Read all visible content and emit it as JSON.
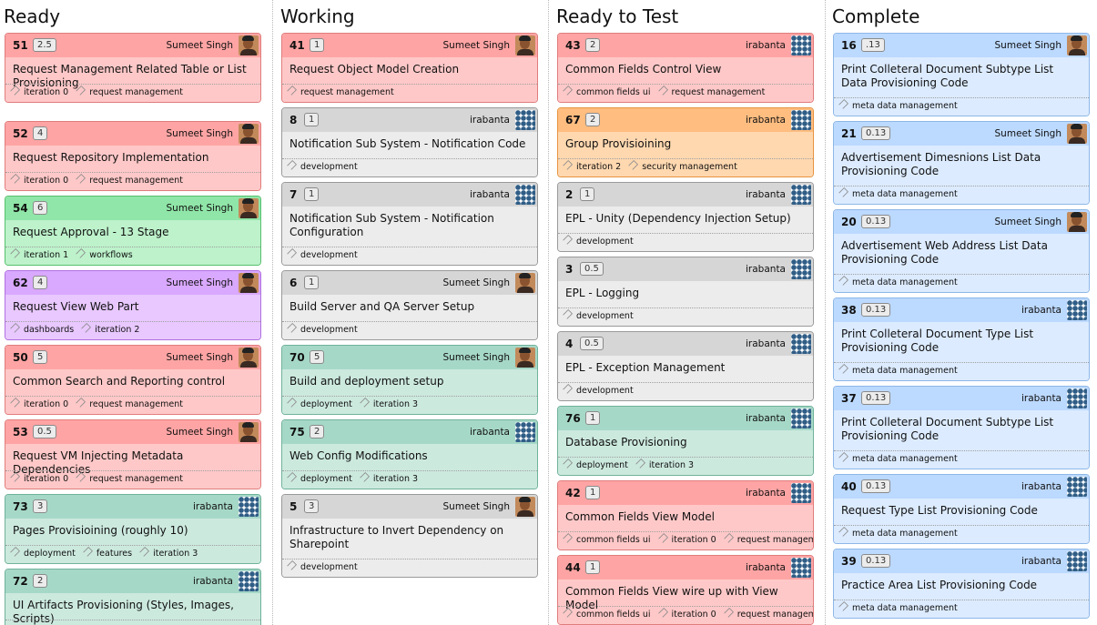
{
  "columns": [
    {
      "title": "Ready",
      "cards": [
        {
          "id": "51",
          "size": "2.5",
          "owner": "Sumeet Singh",
          "avatar": "person",
          "color": "red",
          "title": "Request Management Related Table or List Provisioning",
          "tags": [
            "iteration 0",
            "request management"
          ]
        },
        {
          "id": "52",
          "size": "4",
          "owner": "Sumeet Singh",
          "avatar": "person",
          "color": "red",
          "title": "Request Repository Implementation",
          "tags": [
            "iteration 0",
            "request management"
          ]
        },
        {
          "id": "54",
          "size": "6",
          "owner": "Sumeet Singh",
          "avatar": "person",
          "color": "green",
          "title": "Request Approval - 13 Stage",
          "tags": [
            "iteration 1",
            "workflows"
          ]
        },
        {
          "id": "62",
          "size": "4",
          "owner": "Sumeet Singh",
          "avatar": "person",
          "color": "purple",
          "title": "Request View Web Part",
          "tags": [
            "dashboards",
            "iteration 2"
          ]
        },
        {
          "id": "50",
          "size": "5",
          "owner": "Sumeet Singh",
          "avatar": "person",
          "color": "red",
          "title": "Common Search and Reporting control",
          "tags": [
            "iteration 0",
            "request management"
          ]
        },
        {
          "id": "53",
          "size": "0.5",
          "owner": "Sumeet Singh",
          "avatar": "person",
          "color": "red",
          "title": "Request VM Injecting Metadata Dependencies",
          "tags": [
            "iteration 0",
            "request management"
          ]
        },
        {
          "id": "73",
          "size": "3",
          "owner": "irabanta",
          "avatar": "pattern",
          "color": "teal",
          "title": "Pages Provisioining (roughly 10)",
          "tags": [
            "deployment",
            "features",
            "iteration 3"
          ]
        },
        {
          "id": "72",
          "size": "2",
          "owner": "irabanta",
          "avatar": "pattern",
          "color": "teal",
          "title": "UI Artifacts Provisioning (Styles, Images, Scripts)",
          "tags": []
        }
      ]
    },
    {
      "title": "Working",
      "cards": [
        {
          "id": "41",
          "size": "1",
          "owner": "Sumeet Singh",
          "avatar": "person",
          "color": "red",
          "title": "Request Object Model Creation",
          "tags": [
            "request management"
          ]
        },
        {
          "id": "8",
          "size": "1",
          "owner": "irabanta",
          "avatar": "pattern",
          "color": "gray",
          "title": "Notification Sub System - Notification Code",
          "tags": [
            "development"
          ]
        },
        {
          "id": "7",
          "size": "1",
          "owner": "irabanta",
          "avatar": "pattern",
          "color": "gray",
          "title": "Notification Sub System - Notification Configuration",
          "tags": [
            "development"
          ]
        },
        {
          "id": "6",
          "size": "1",
          "owner": "Sumeet Singh",
          "avatar": "person",
          "color": "gray",
          "title": "Build Server and QA Server Setup",
          "tags": [
            "development"
          ]
        },
        {
          "id": "70",
          "size": "5",
          "owner": "Sumeet Singh",
          "avatar": "person",
          "color": "teal",
          "title": "Build and deployment setup",
          "tags": [
            "deployment",
            "iteration 3"
          ]
        },
        {
          "id": "75",
          "size": "2",
          "owner": "irabanta",
          "avatar": "pattern",
          "color": "teal",
          "title": "Web Config Modifications",
          "tags": [
            "deployment",
            "iteration 3"
          ]
        },
        {
          "id": "5",
          "size": "3",
          "owner": "Sumeet Singh",
          "avatar": "person",
          "color": "gray",
          "title": "Infrastructure to Invert Dependency on Sharepoint",
          "tags": [
            "development"
          ]
        }
      ]
    },
    {
      "title": "Ready to Test",
      "cards": [
        {
          "id": "43",
          "size": "2",
          "owner": "irabanta",
          "avatar": "pattern",
          "color": "red",
          "title": "Common Fields Control View",
          "tags": [
            "common fields ui",
            "request management"
          ]
        },
        {
          "id": "67",
          "size": "2",
          "owner": "irabanta",
          "avatar": "pattern",
          "color": "orange",
          "title": "Group Provisioining",
          "tags": [
            "iteration 2",
            "security management"
          ]
        },
        {
          "id": "2",
          "size": "1",
          "owner": "irabanta",
          "avatar": "pattern",
          "color": "gray",
          "title": "EPL - Unity (Dependency Injection Setup)",
          "tags": [
            "development"
          ]
        },
        {
          "id": "3",
          "size": "0.5",
          "owner": "irabanta",
          "avatar": "pattern",
          "color": "gray",
          "title": "EPL - Logging",
          "tags": [
            "development"
          ]
        },
        {
          "id": "4",
          "size": "0.5",
          "owner": "irabanta",
          "avatar": "pattern",
          "color": "gray",
          "title": "EPL - Exception Management",
          "tags": [
            "development"
          ]
        },
        {
          "id": "76",
          "size": "1",
          "owner": "irabanta",
          "avatar": "pattern",
          "color": "teal",
          "title": "Database Provisioning",
          "tags": [
            "deployment",
            "iteration 3"
          ]
        },
        {
          "id": "42",
          "size": "1",
          "owner": "irabanta",
          "avatar": "pattern",
          "color": "red",
          "title": "Common Fields View Model",
          "tags": [
            "common fields ui",
            "iteration 0",
            "request management"
          ]
        },
        {
          "id": "44",
          "size": "1",
          "owner": "irabanta",
          "avatar": "pattern",
          "color": "red",
          "title": "Common Fields View wire up with View Model",
          "tags": [
            "common fields ui",
            "iteration 0",
            "request management"
          ]
        }
      ]
    },
    {
      "title": "Complete",
      "cards": [
        {
          "id": "16",
          "size": ".13",
          "owner": "Sumeet Singh",
          "avatar": "person",
          "color": "blue",
          "title": "Print Colleteral Document Subtype List Data Provisioning Code",
          "tags": [
            "meta data management"
          ]
        },
        {
          "id": "21",
          "size": "0.13",
          "owner": "Sumeet Singh",
          "avatar": "person",
          "color": "blue",
          "title": "Advertisement Dimesnions List Data Provisioning Code",
          "tags": [
            "meta data management"
          ]
        },
        {
          "id": "20",
          "size": "0.13",
          "owner": "Sumeet Singh",
          "avatar": "person",
          "color": "blue",
          "title": "Advertisement Web Address List Data Provisioning Code",
          "tags": [
            "meta data management"
          ]
        },
        {
          "id": "38",
          "size": "0.13",
          "owner": "irabanta",
          "avatar": "pattern",
          "color": "blue",
          "title": "Print Colleteral Document Type List Provisioning Code",
          "tags": [
            "meta data management"
          ]
        },
        {
          "id": "37",
          "size": "0.13",
          "owner": "irabanta",
          "avatar": "pattern",
          "color": "blue",
          "title": "Print Colleteral Document Subtype List Provisioning Code",
          "tags": [
            "meta data management"
          ]
        },
        {
          "id": "40",
          "size": "0.13",
          "owner": "irabanta",
          "avatar": "pattern",
          "color": "blue",
          "title": "Request Type List Provisioning Code",
          "tags": [
            "meta data management"
          ]
        },
        {
          "id": "39",
          "size": "0.13",
          "owner": "irabanta",
          "avatar": "pattern",
          "color": "blue",
          "title": "Practice Area List Provisioning Code",
          "tags": [
            "meta data management"
          ]
        }
      ]
    }
  ]
}
